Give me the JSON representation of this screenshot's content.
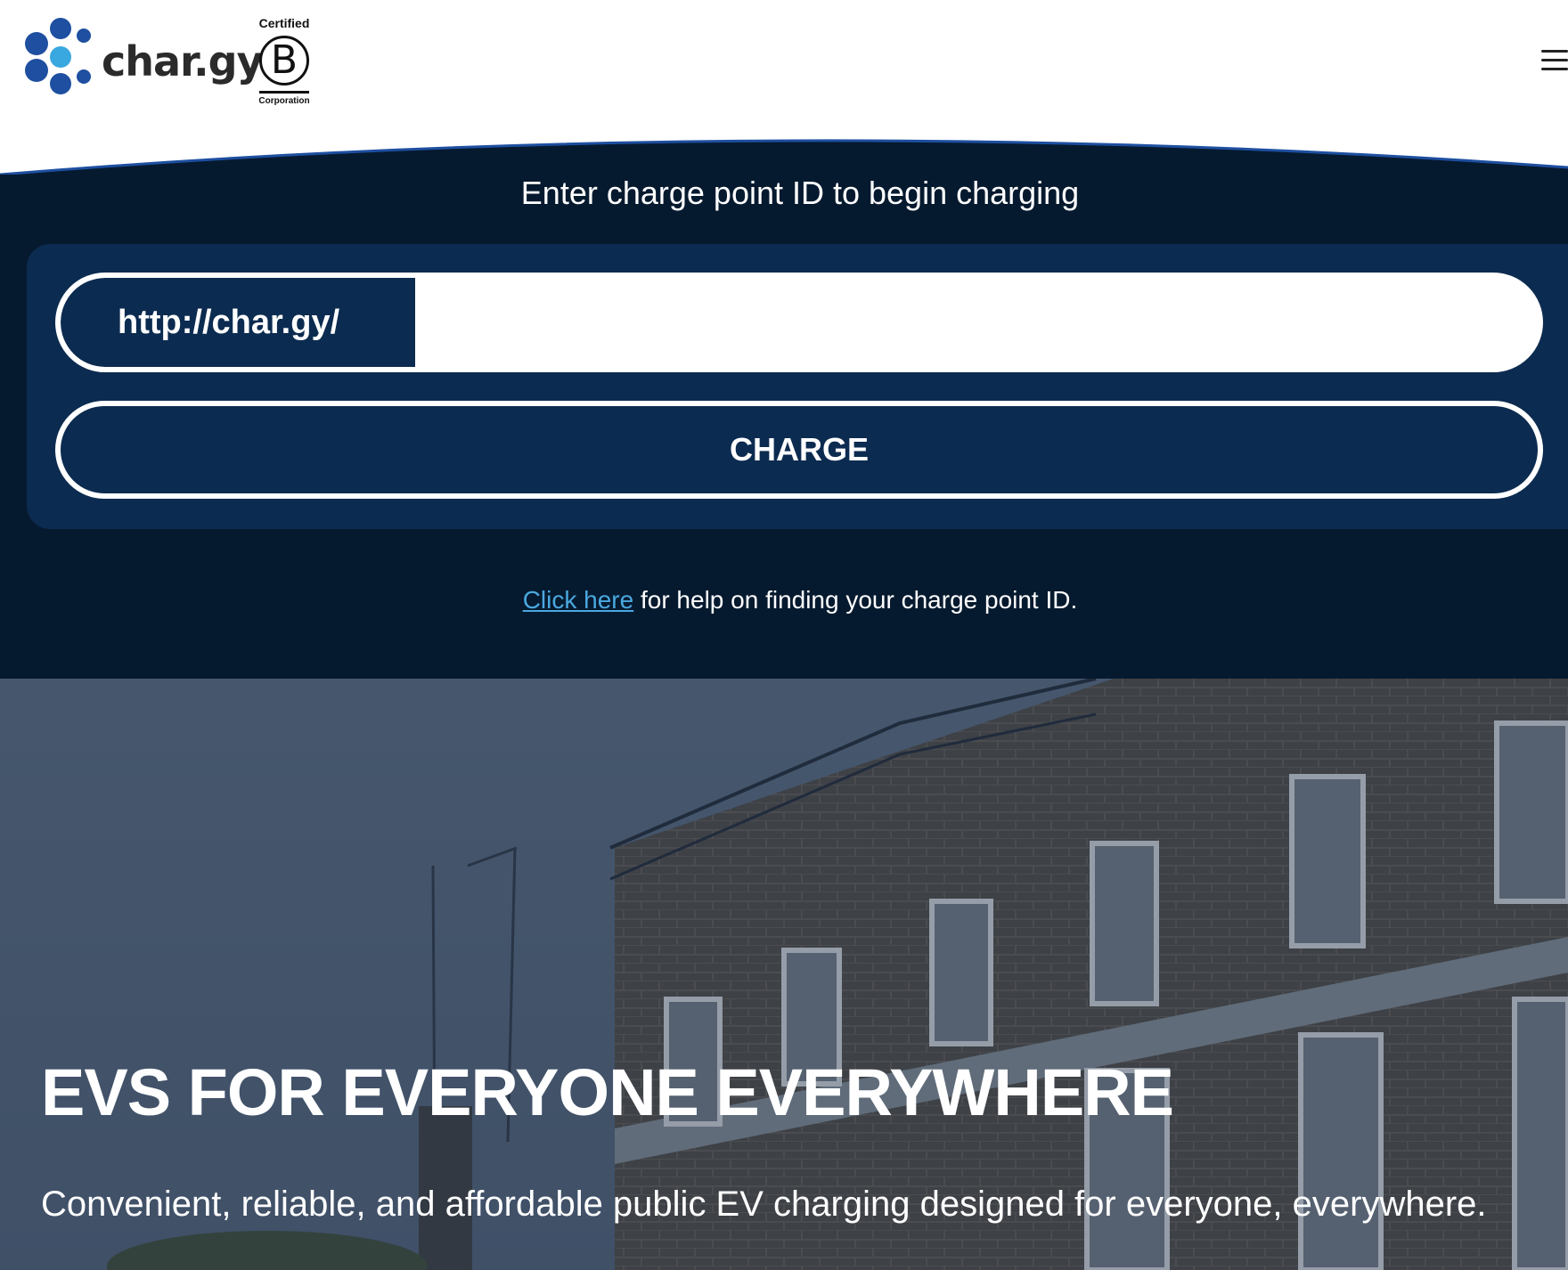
{
  "header": {
    "logo_text": "char.gy",
    "bcorp": {
      "top_label": "Certified",
      "letter": "B",
      "bottom_label": "Corporation"
    },
    "menu_icon": "hamburger-menu-icon"
  },
  "charge": {
    "title": "Enter charge point ID to begin charging",
    "url_prefix": "http://char.gy/",
    "input_value": "",
    "button_label": "CHARGE",
    "help_link": "Click here",
    "help_text": " for help on finding your charge point ID."
  },
  "hero": {
    "title": "EVS FOR EVERYONE EVERYWHERE",
    "subtitle": "Convenient, reliable, and affordable public EV charging designed for everyone, everywhere."
  },
  "colors": {
    "navy_dark": "#061a2f",
    "navy_panel": "#0c2b50",
    "brand_blue": "#1e4fa0",
    "brand_light_blue": "#3aa8e0",
    "link": "#4aa8e0"
  }
}
